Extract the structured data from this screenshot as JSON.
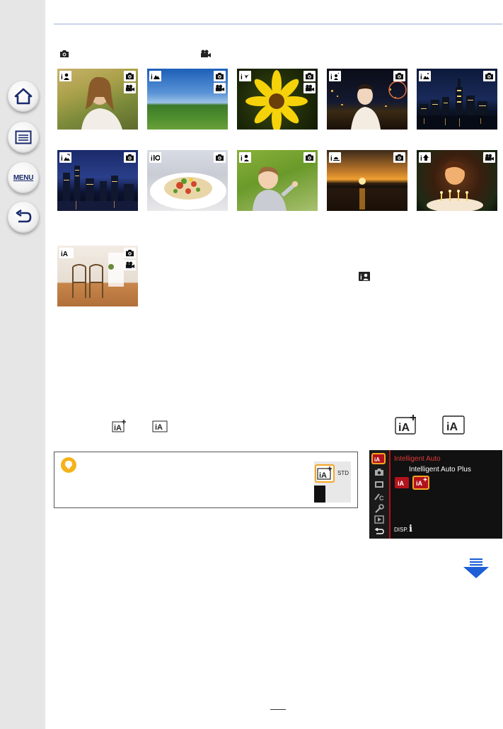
{
  "nav": {
    "items": [
      {
        "name": "home",
        "icon": "home-icon"
      },
      {
        "name": "contents",
        "icon": "list-icon"
      },
      {
        "name": "menu",
        "icon": "menu-icon",
        "label": "MENU"
      },
      {
        "name": "back",
        "icon": "back-arrow-icon"
      }
    ]
  },
  "legend": {
    "photo_icon": "camera-icon",
    "video_icon": "movie-camera-icon"
  },
  "scenes": [
    {
      "id": "i-portrait",
      "scene_icon": "i-portrait-icon",
      "photo": true,
      "video": true
    },
    {
      "id": "i-scenery",
      "scene_icon": "i-scenery-icon",
      "photo": true,
      "video": true
    },
    {
      "id": "i-macro",
      "scene_icon": "i-macro-icon",
      "photo": true,
      "video": true
    },
    {
      "id": "i-night-portrait",
      "scene_icon": "i-night-portrait-icon",
      "photo": true,
      "video": false
    },
    {
      "id": "i-night-scenery",
      "scene_icon": "i-night-scenery-icon",
      "photo": true,
      "video": false
    },
    {
      "id": "i-handheld-night-shot",
      "scene_icon": "i-handheld-night-icon",
      "photo": true,
      "video": false
    },
    {
      "id": "i-food",
      "scene_icon": "i-food-icon",
      "photo": true,
      "video": false
    },
    {
      "id": "i-baby",
      "scene_icon": "i-baby-icon",
      "photo": true,
      "video": false
    },
    {
      "id": "i-sunset",
      "scene_icon": "i-sunset-icon",
      "photo": true,
      "video": false
    },
    {
      "id": "i-low-light",
      "scene_icon": "i-low-light-icon",
      "photo": false,
      "video": true
    },
    {
      "id": "intelligent-auto",
      "scene_icon": "intelligent-auto-icon",
      "photo": true,
      "video": true
    }
  ],
  "inline_icon": "i-baby-icon",
  "modes": {
    "text_icons": [
      "intelligent-auto-plus-icon",
      "intelligent-auto-icon"
    ],
    "large_icons": [
      "intelligent-auto-plus-icon",
      "intelligent-auto-icon"
    ]
  },
  "tip": {
    "icon": "lightbulb-icon",
    "thumb_badge": "STD"
  },
  "camera_menu": {
    "title": "Intelligent Auto",
    "option": "Intelligent Auto Plus",
    "disp_label": "DISP.",
    "info_label": "i",
    "colors": {
      "accent_red": "#e23a3a",
      "highlight": "#f5a623",
      "background": "#111111"
    }
  },
  "next_page_icon": "next-page-arrow-icon"
}
